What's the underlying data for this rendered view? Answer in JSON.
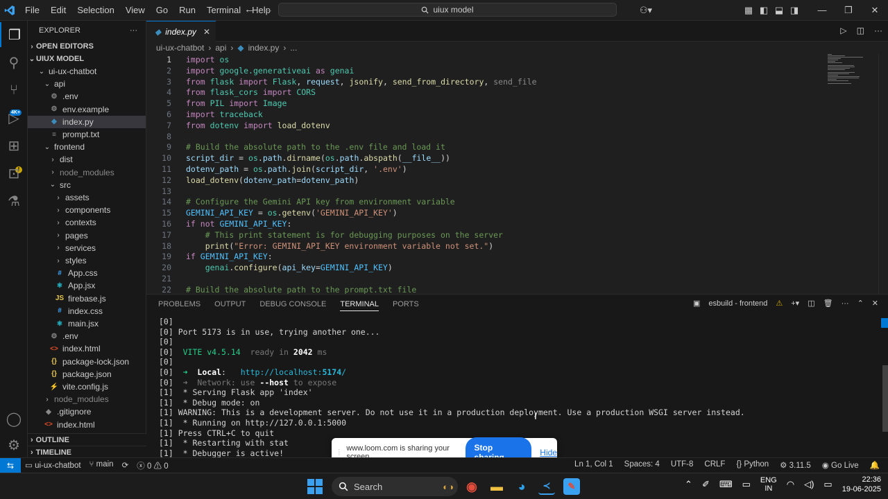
{
  "titlebar": {
    "menus": [
      "File",
      "Edit",
      "Selection",
      "View",
      "Go",
      "Run",
      "Terminal",
      "Help"
    ],
    "search_text": "uiux model",
    "nav_back": "←",
    "nav_forward": "→"
  },
  "sidebar": {
    "title": "EXPLORER",
    "open_editors": "OPEN EDITORS",
    "workspace": "UIUX MODEL",
    "tree": [
      {
        "label": "ui-ux-chatbot",
        "indent": 1,
        "type": "folder",
        "open": true
      },
      {
        "label": "api",
        "indent": 2,
        "type": "folder",
        "open": true
      },
      {
        "label": ".env",
        "indent": 3,
        "type": "env"
      },
      {
        "label": "env.example",
        "indent": 3,
        "type": "env"
      },
      {
        "label": "index.py",
        "indent": 3,
        "type": "py",
        "selected": true
      },
      {
        "label": "prompt.txt",
        "indent": 3,
        "type": "txt"
      },
      {
        "label": "frontend",
        "indent": 2,
        "type": "folder",
        "open": true
      },
      {
        "label": "dist",
        "indent": 3,
        "type": "folder",
        "open": false
      },
      {
        "label": "node_modules",
        "indent": 3,
        "type": "folder",
        "open": false,
        "dim": true
      },
      {
        "label": "src",
        "indent": 3,
        "type": "folder",
        "open": true
      },
      {
        "label": "assets",
        "indent": 4,
        "type": "folder",
        "open": false
      },
      {
        "label": "components",
        "indent": 4,
        "type": "folder",
        "open": false
      },
      {
        "label": "contexts",
        "indent": 4,
        "type": "folder",
        "open": false
      },
      {
        "label": "pages",
        "indent": 4,
        "type": "folder",
        "open": false
      },
      {
        "label": "services",
        "indent": 4,
        "type": "folder",
        "open": false
      },
      {
        "label": "styles",
        "indent": 4,
        "type": "folder",
        "open": false
      },
      {
        "label": "App.css",
        "indent": 4,
        "type": "css"
      },
      {
        "label": "App.jsx",
        "indent": 4,
        "type": "jsx"
      },
      {
        "label": "firebase.js",
        "indent": 4,
        "type": "js"
      },
      {
        "label": "index.css",
        "indent": 4,
        "type": "css"
      },
      {
        "label": "main.jsx",
        "indent": 4,
        "type": "jsx"
      },
      {
        "label": ".env",
        "indent": 3,
        "type": "env"
      },
      {
        "label": "index.html",
        "indent": 3,
        "type": "html"
      },
      {
        "label": "package-lock.json",
        "indent": 3,
        "type": "json"
      },
      {
        "label": "package.json",
        "indent": 3,
        "type": "json"
      },
      {
        "label": "vite.config.js",
        "indent": 3,
        "type": "vite"
      },
      {
        "label": "node_modules",
        "indent": 2,
        "type": "folder",
        "open": false,
        "dim": true
      },
      {
        "label": ".gitignore",
        "indent": 2,
        "type": "git"
      },
      {
        "label": "index.html",
        "indent": 2,
        "type": "html"
      }
    ],
    "outline": "OUTLINE",
    "timeline": "TIMELINE"
  },
  "editor": {
    "tab_label": "index.py",
    "breadcrumb": [
      "ui-ux-chatbot",
      "api",
      "index.py",
      "..."
    ],
    "current_line": 1,
    "lines": [
      [
        [
          "kw",
          "import"
        ],
        [
          "pl",
          " "
        ],
        [
          "cl",
          "os"
        ]
      ],
      [
        [
          "kw",
          "import"
        ],
        [
          "pl",
          " "
        ],
        [
          "cl",
          "google.generativeai"
        ],
        [
          "pl",
          " "
        ],
        [
          "kw",
          "as"
        ],
        [
          "pl",
          " "
        ],
        [
          "cl",
          "genai"
        ]
      ],
      [
        [
          "kw",
          "from"
        ],
        [
          "pl",
          " "
        ],
        [
          "cl",
          "flask"
        ],
        [
          "pl",
          " "
        ],
        [
          "kw",
          "import"
        ],
        [
          "pl",
          " "
        ],
        [
          "cl",
          "Flask"
        ],
        [
          "pl",
          ", "
        ],
        [
          "vr",
          "request"
        ],
        [
          "pl",
          ", "
        ],
        [
          "fn",
          "jsonify"
        ],
        [
          "pl",
          ", "
        ],
        [
          "fn",
          "send_from_directory"
        ],
        [
          "pl",
          ", "
        ],
        [
          "dim",
          "send_file"
        ]
      ],
      [
        [
          "kw",
          "from"
        ],
        [
          "pl",
          " "
        ],
        [
          "cl",
          "flask_cors"
        ],
        [
          "pl",
          " "
        ],
        [
          "kw",
          "import"
        ],
        [
          "pl",
          " "
        ],
        [
          "cl",
          "CORS"
        ]
      ],
      [
        [
          "kw",
          "from"
        ],
        [
          "pl",
          " "
        ],
        [
          "cl",
          "PIL"
        ],
        [
          "pl",
          " "
        ],
        [
          "kw",
          "import"
        ],
        [
          "pl",
          " "
        ],
        [
          "cl",
          "Image"
        ]
      ],
      [
        [
          "kw",
          "import"
        ],
        [
          "pl",
          " "
        ],
        [
          "cl",
          "traceback"
        ]
      ],
      [
        [
          "kw",
          "from"
        ],
        [
          "pl",
          " "
        ],
        [
          "cl",
          "dotenv"
        ],
        [
          "pl",
          " "
        ],
        [
          "kw",
          "import"
        ],
        [
          "pl",
          " "
        ],
        [
          "fn",
          "load_dotenv"
        ]
      ],
      [],
      [
        [
          "cm",
          "# Build the absolute path to the .env file and load it"
        ]
      ],
      [
        [
          "vr",
          "script_dir"
        ],
        [
          "pl",
          " = "
        ],
        [
          "cl",
          "os"
        ],
        [
          "pl",
          "."
        ],
        [
          "vr",
          "path"
        ],
        [
          "pl",
          "."
        ],
        [
          "fn",
          "dirname"
        ],
        [
          "pl",
          "("
        ],
        [
          "cl",
          "os"
        ],
        [
          "pl",
          "."
        ],
        [
          "vr",
          "path"
        ],
        [
          "pl",
          "."
        ],
        [
          "fn",
          "abspath"
        ],
        [
          "pl",
          "("
        ],
        [
          "vr",
          "__file__"
        ],
        [
          "pl",
          "))"
        ]
      ],
      [
        [
          "vr",
          "dotenv_path"
        ],
        [
          "pl",
          " = "
        ],
        [
          "cl",
          "os"
        ],
        [
          "pl",
          "."
        ],
        [
          "vr",
          "path"
        ],
        [
          "pl",
          "."
        ],
        [
          "fn",
          "join"
        ],
        [
          "pl",
          "("
        ],
        [
          "vr",
          "script_dir"
        ],
        [
          "pl",
          ", "
        ],
        [
          "st",
          "'.env'"
        ],
        [
          "pl",
          ")"
        ]
      ],
      [
        [
          "fn",
          "load_dotenv"
        ],
        [
          "pl",
          "("
        ],
        [
          "vr",
          "dotenv_path"
        ],
        [
          "pl",
          "="
        ],
        [
          "vr",
          "dotenv_path"
        ],
        [
          "pl",
          ")"
        ]
      ],
      [],
      [
        [
          "cm",
          "# Configure the Gemini API key from environment variable"
        ]
      ],
      [
        [
          "cs",
          "GEMINI_API_KEY"
        ],
        [
          "pl",
          " = "
        ],
        [
          "cl",
          "os"
        ],
        [
          "pl",
          "."
        ],
        [
          "fn",
          "getenv"
        ],
        [
          "pl",
          "("
        ],
        [
          "st",
          "'GEMINI_API_KEY'"
        ],
        [
          "pl",
          ")"
        ]
      ],
      [
        [
          "kw",
          "if"
        ],
        [
          "pl",
          " "
        ],
        [
          "kw",
          "not"
        ],
        [
          "pl",
          " "
        ],
        [
          "cs",
          "GEMINI_API_KEY"
        ],
        [
          "pl",
          ":"
        ]
      ],
      [
        [
          "pl",
          "    "
        ],
        [
          "cm",
          "# This print statement is for debugging purposes on the server"
        ]
      ],
      [
        [
          "pl",
          "    "
        ],
        [
          "fn",
          "print"
        ],
        [
          "pl",
          "("
        ],
        [
          "st",
          "\"Error: GEMINI_API_KEY environment variable not set.\""
        ],
        [
          "pl",
          ")"
        ]
      ],
      [
        [
          "kw",
          "if"
        ],
        [
          "pl",
          " "
        ],
        [
          "cs",
          "GEMINI_API_KEY"
        ],
        [
          "pl",
          ":"
        ]
      ],
      [
        [
          "pl",
          "    "
        ],
        [
          "cl",
          "genai"
        ],
        [
          "pl",
          "."
        ],
        [
          "fn",
          "configure"
        ],
        [
          "pl",
          "("
        ],
        [
          "vr",
          "api_key"
        ],
        [
          "pl",
          "="
        ],
        [
          "cs",
          "GEMINI_API_KEY"
        ],
        [
          "pl",
          ")"
        ]
      ],
      [],
      [
        [
          "cm",
          "# Build the absolute path to the prompt.txt file"
        ]
      ]
    ]
  },
  "panel": {
    "tabs": [
      "PROBLEMS",
      "OUTPUT",
      "DEBUG CONSOLE",
      "TERMINAL",
      "PORTS"
    ],
    "active_tab": "TERMINAL",
    "terminal_name": "esbuild - frontend",
    "terminal_lines": [
      [
        [
          "pl",
          "[0]"
        ]
      ],
      [
        [
          "pl",
          "[0] Port 5173 is in use, trying another one..."
        ]
      ],
      [
        [
          "pl",
          "[0]"
        ]
      ],
      [
        [
          "pl",
          "[0]  "
        ],
        [
          "g",
          "VITE v4.5.14"
        ],
        [
          "tdim",
          "  ready in "
        ],
        [
          "bold",
          "2042"
        ],
        [
          "tdim",
          " ms"
        ]
      ],
      [
        [
          "pl",
          "[0]"
        ]
      ],
      [
        [
          "pl",
          "[0]  "
        ],
        [
          "g",
          "➜"
        ],
        [
          "pl",
          "  "
        ],
        [
          "bold",
          "Local"
        ],
        [
          "pl",
          ":   "
        ],
        [
          "cy",
          "http://localhost:"
        ],
        [
          "bold cy",
          "5174"
        ],
        [
          "cy",
          "/"
        ]
      ],
      [
        [
          "pl",
          "[0]  "
        ],
        [
          "tdim",
          "➜  Network: use "
        ],
        [
          "bold",
          "--host"
        ],
        [
          "tdim",
          " to expose"
        ]
      ],
      [
        [
          "pl",
          "[1]  * Serving Flask app 'index'"
        ]
      ],
      [
        [
          "pl",
          "[1]  * Debug mode: on"
        ]
      ],
      [
        [
          "pl",
          "[1] WARNING: This is a development server. Do not use it in a production deployment. Use a production WSGI server instead."
        ]
      ],
      [
        [
          "pl",
          "[1]  * Running on http://127.0.0.1:5000"
        ]
      ],
      [
        [
          "pl",
          "[1] Press CTRL+C to quit"
        ]
      ],
      [
        [
          "pl",
          "[1]  * Restarting with stat"
        ]
      ],
      [
        [
          "pl",
          "[1]  * Debugger is active!"
        ]
      ]
    ]
  },
  "loom": {
    "message": "www.loom.com is sharing your screen.",
    "stop_label": "Stop sharing",
    "hide_label": "Hide"
  },
  "statusbar": {
    "repo": "ui-ux-chatbot",
    "branch": "main",
    "errors": "0",
    "warnings": "0",
    "position": "Ln 1, Col 1",
    "spaces": "Spaces: 4",
    "encoding": "UTF-8",
    "eol": "CRLF",
    "language": "Python",
    "python_version": "3.11.5",
    "go_live": "Go Live"
  },
  "taskbar": {
    "search_label": "Search",
    "lang_top": "ENG",
    "lang_bottom": "IN",
    "time": "22:36",
    "date": "19-06-2025"
  }
}
